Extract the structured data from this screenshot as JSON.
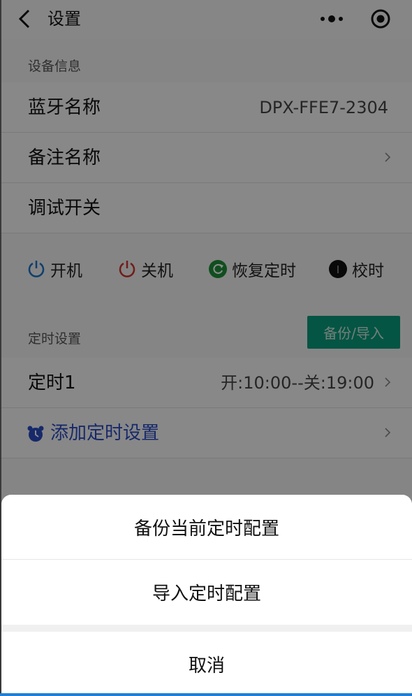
{
  "nav": {
    "title": "设置",
    "back_icon": "chevron-left-icon",
    "more_icon": "more-dots-icon",
    "close_icon": "target-close-icon"
  },
  "device_info": {
    "section_label": "设备信息",
    "rows": [
      {
        "label": "蓝牙名称",
        "value": "DPX-FFE7-2304"
      },
      {
        "label": "备注名称",
        "value": ""
      },
      {
        "label": "调试开关",
        "value": ""
      }
    ]
  },
  "controls": [
    {
      "label": "开机",
      "icon": "power-icon",
      "color": "#1a73c9"
    },
    {
      "label": "关机",
      "icon": "power-icon",
      "color": "#d0332e"
    },
    {
      "label": "恢复定时",
      "icon": "refresh-icon",
      "color": "#1f8f3a"
    },
    {
      "label": "校时",
      "icon": "info-dot-icon",
      "color": "#111111"
    }
  ],
  "timer_settings": {
    "section_label": "定时设置",
    "backup_button": "备份/导入",
    "timers": [
      {
        "label": "定时1",
        "value": "开:10:00--关:19:00"
      }
    ],
    "add_label": "添加定时设置",
    "add_icon": "alarm-clock-icon"
  },
  "action_sheet": {
    "items": [
      "备份当前定时配置",
      "导入定时配置"
    ],
    "cancel": "取消"
  },
  "colors": {
    "accent": "#0a9c7c",
    "link": "#2a4cc2",
    "system_bar": "#1e7fd6"
  }
}
